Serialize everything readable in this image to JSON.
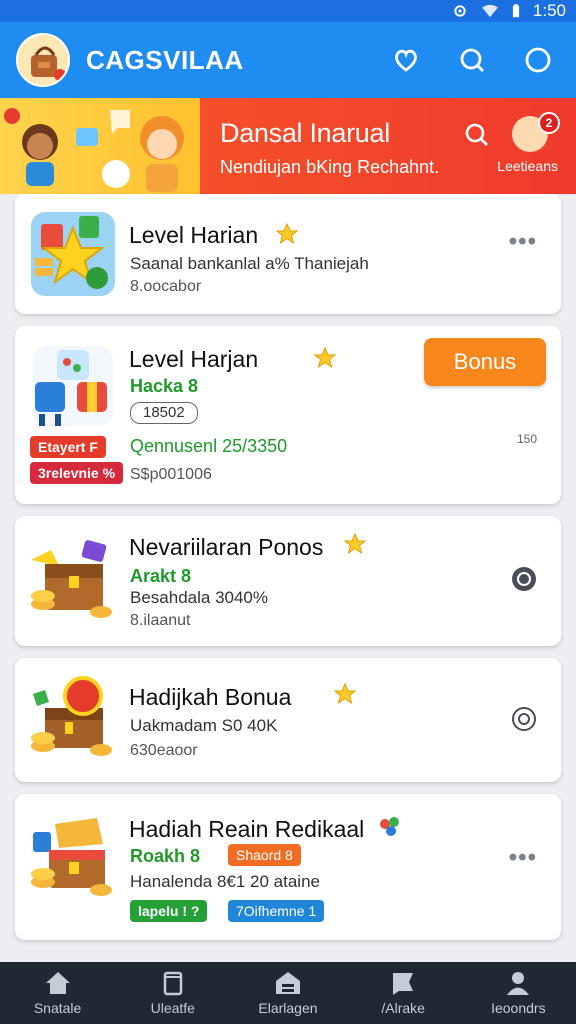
{
  "status": {
    "time": "1:50"
  },
  "appbar": {
    "title": "CAGSVILAA"
  },
  "banner": {
    "title": "Dansal Inarual",
    "subtitle": "Nendiujan bKing Rechahnt.",
    "avatar_label": "Leetieans",
    "badge": "2"
  },
  "cards": [
    {
      "title": "Level Harian",
      "line1": "Saanal bankanlal a% Thaniejah",
      "line2": "8.oocabor"
    },
    {
      "title": "Level Harjan",
      "green1": "Hacka 8",
      "outline": "18502",
      "green2": "Qennusenl 25/3350",
      "line": "S$p001006",
      "tag1": "Etayert F",
      "tag2": "3relevnie %",
      "button": "Bonus",
      "tiny": "150"
    },
    {
      "title": "Nevariilaran Ponos",
      "green1": "Arakt 8",
      "line1": "Besahdala 3040%",
      "line2": "8.ilaanut"
    },
    {
      "title": "Hadijkah Bonua",
      "line1": "Uakmadam S0 40K",
      "line2": "630eaoor"
    },
    {
      "title": "Hadiah Reain Redikaal",
      "green1": "Roakh 8",
      "orange_tag": "Shaord 8",
      "line1": "Hanalenda 8€1 20 ataine",
      "tag_green": "lapelu ! ?",
      "tag_blue": "7Oifhemne 1"
    }
  ],
  "nav": [
    {
      "label": "Snatale"
    },
    {
      "label": "Uleatfe"
    },
    {
      "label": "Elarlagen"
    },
    {
      "label": "/Alrake"
    },
    {
      "label": "Ieoondrs"
    }
  ],
  "colors": {
    "appbar": "#1f8cf1",
    "banner_red": "#f03a2c",
    "bonus_orange": "#f7861b",
    "green": "#1f9a2a",
    "nav_bg": "#202833"
  }
}
